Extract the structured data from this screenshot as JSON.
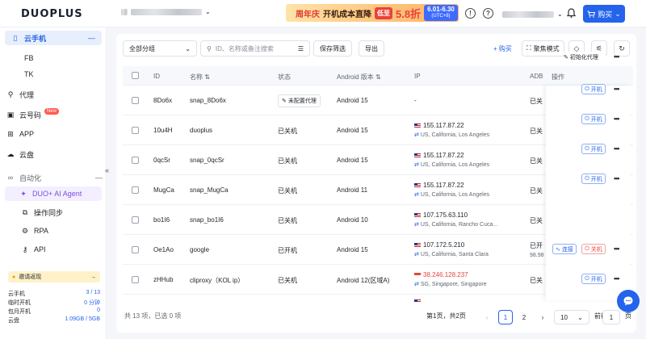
{
  "app": {
    "logo_text": "DUOPLUS",
    "accent": "#2463eb"
  },
  "banner": {
    "part1": "周年庆",
    "part2": "开机成本直降",
    "pill": "低至",
    "discount": "5.8折",
    "date": "6.01-6.30",
    "tz": "(UTC+8)"
  },
  "topbar": {
    "buy_label": "购买",
    "help_icon": "?",
    "notice_icon": "!"
  },
  "sidebar": {
    "items": [
      {
        "label": "云手机",
        "icon": "phone-icon"
      },
      {
        "label": "FB"
      },
      {
        "label": "TK"
      },
      {
        "label": "代理",
        "icon": "proxy-icon"
      },
      {
        "label": "云号码",
        "badge": "New"
      },
      {
        "label": "APP"
      },
      {
        "label": "云盘"
      },
      {
        "label": "自动化"
      },
      {
        "label": "DUO+ AI Agent"
      },
      {
        "label": "操作同步"
      },
      {
        "label": "RPA"
      },
      {
        "label": "API"
      }
    ],
    "promo": "邀请返现",
    "stats": [
      {
        "label": "云手机",
        "value": "3 / 13"
      },
      {
        "label": "临时开机",
        "value": "0 分钟"
      },
      {
        "label": "包月开机",
        "value": "0"
      },
      {
        "label": "云盘",
        "value": "1.09GB / 5GB"
      }
    ]
  },
  "toolbar": {
    "group_select": "全部分组",
    "search_placeholder": "ID、名称或备注搜索",
    "save_filter": "保存筛选",
    "export": "导出",
    "buy": "+ 购买",
    "focus_mode": "聚焦模式"
  },
  "table": {
    "columns": [
      "ID",
      "名称",
      "状态",
      "Android 版本",
      "IP",
      "ADB",
      "操作"
    ],
    "rows": [
      {
        "id": "8Do6x",
        "name": "snap_8Do6x",
        "status": "未配置代理",
        "android": "Android 15",
        "ip": "-",
        "loc": "",
        "adb": "已关",
        "action": "初始化代理"
      },
      {
        "id": "10u4H",
        "name": "duoplus",
        "status": "已关机",
        "android": "Android 15",
        "ip": "155.117.87.22",
        "loc": "US, California, Los Angeles",
        "adb": "已关",
        "action": "开机"
      },
      {
        "id": "0qcSr",
        "name": "snap_0qcSr",
        "status": "已关机",
        "android": "Android 15",
        "ip": "155.117.87.22",
        "loc": "US, California, Los Angeles",
        "adb": "已关",
        "action": "开机"
      },
      {
        "id": "MugCa",
        "name": "snap_MugCa",
        "status": "已关机",
        "android": "Android 11",
        "ip": "155.117.87.22",
        "loc": "US, California, Los Angeles",
        "adb": "已关",
        "action": "开机"
      },
      {
        "id": "bo1I6",
        "name": "snap_bo1I6",
        "status": "已关机",
        "android": "Android 10",
        "ip": "107.175.63.110",
        "loc": "US, California, Rancho Cuca...",
        "adb": "已关",
        "action": "开机"
      },
      {
        "id": "Oe1Ao",
        "name": "google",
        "status": "已开机",
        "android": "Android 15",
        "ip": "107.172.5.210",
        "loc": "US, California, Santa Clara",
        "adb": "已开",
        "adb2": "98.98",
        "action": "连接",
        "action2": "关机"
      },
      {
        "id": "zHHub",
        "name": "cliproxy（KOL ip）",
        "status": "已关机",
        "android": "Android 12(区域A)",
        "ip": "38.246.128.237",
        "loc": "SG, Singapore, Singapore",
        "adb": "已关",
        "action": "开机"
      }
    ]
  },
  "footer": {
    "summary": "共 13 项，已选 0 项",
    "page_info": "第1页，共2页",
    "pages": [
      "1",
      "2"
    ],
    "page_size": "10",
    "goto_label": "前往",
    "goto_value": "1",
    "goto_unit": "页"
  }
}
